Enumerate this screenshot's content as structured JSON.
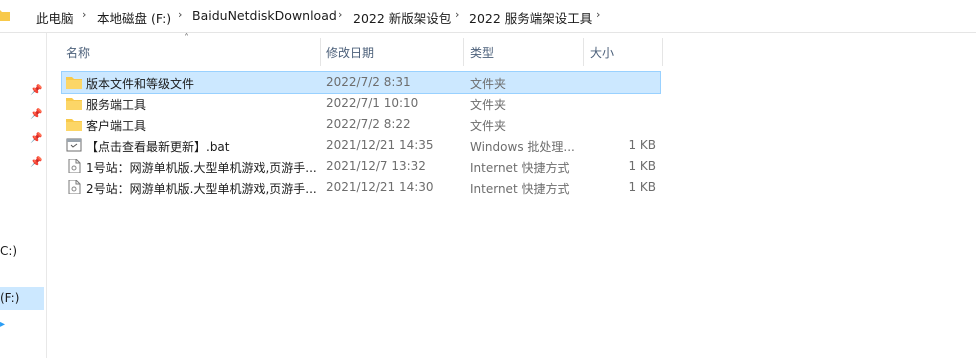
{
  "breadcrumb": [
    {
      "label": "此电脑"
    },
    {
      "label": "本地磁盘 (F:)"
    },
    {
      "label": "BaiduNetdiskDownload"
    },
    {
      "label": "2022 新版架设包"
    },
    {
      "label": "2022 服务端架设工具"
    }
  ],
  "nav": {
    "drive_c_label": "C:)",
    "drive_f_label": "(F:)"
  },
  "columns": {
    "name": "名称",
    "date": "修改日期",
    "type": "类型",
    "size": "大小"
  },
  "files": [
    {
      "name": "版本文件和等级文件",
      "date": "2022/7/2 8:31",
      "type": "文件夹",
      "size": "",
      "icon": "folder-icon"
    },
    {
      "name": "服务端工具",
      "date": "2022/7/1 10:10",
      "type": "文件夹",
      "size": "",
      "icon": "folder-icon"
    },
    {
      "name": "客户端工具",
      "date": "2022/7/2 8:22",
      "type": "文件夹",
      "size": "",
      "icon": "folder-icon"
    },
    {
      "name": "【点击查看最新更新】.bat",
      "date": "2021/12/21 14:35",
      "type": "Windows 批处理...",
      "size": "1 KB",
      "icon": "batch-file-icon"
    },
    {
      "name": "1号站：网游单机版.大型单机游戏,页游手...",
      "date": "2021/12/7 13:32",
      "type": "Internet 快捷方式",
      "size": "1 KB",
      "icon": "internet-shortcut-icon"
    },
    {
      "name": "2号站：网游单机版.大型单机游戏,页游手...",
      "date": "2021/12/21 14:30",
      "type": "Internet 快捷方式",
      "size": "1 KB",
      "icon": "internet-shortcut-icon"
    }
  ],
  "colors": {
    "selection": "#cce8ff",
    "selection_border": "#99d1ff",
    "folder": "#f8c94a"
  }
}
